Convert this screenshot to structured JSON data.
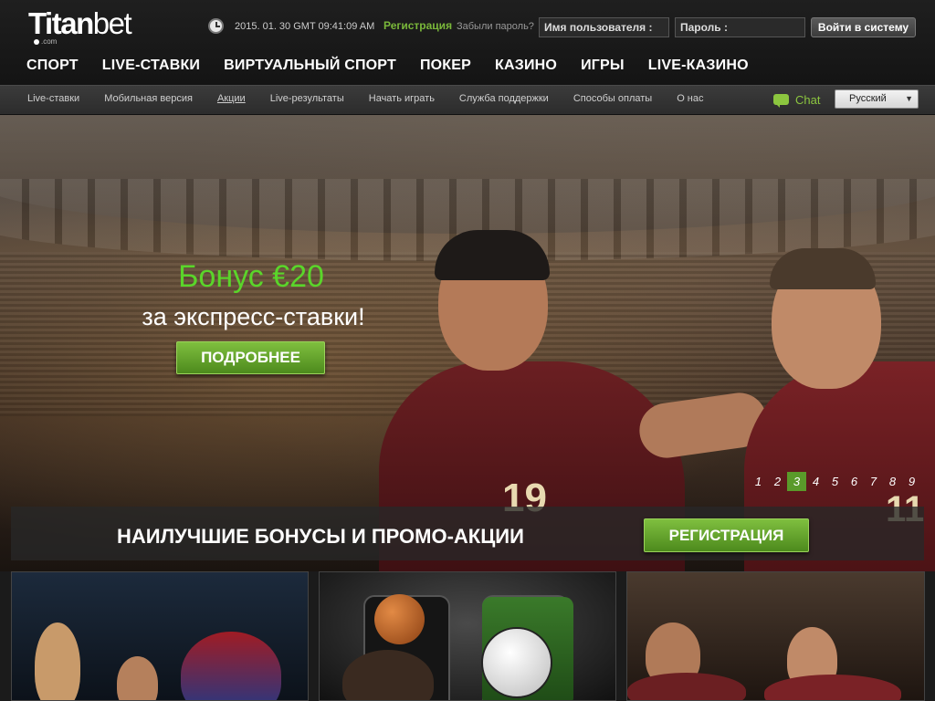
{
  "header": {
    "logo_text_bold": "Titan",
    "logo_text_light": "bet",
    "logo_sub": ".com",
    "datetime": "2015. 01. 30 GMT 09:41:09 AM",
    "register_link": "Регистрация",
    "forgot_password": "Забыли пароль?",
    "username_placeholder": "Имя пользователя :",
    "password_placeholder": "Пароль :",
    "login_button": "Войти в систему"
  },
  "main_nav": [
    {
      "label": "СПОРТ"
    },
    {
      "label": "LIVE-СТАВКИ"
    },
    {
      "label": "ВИРТУАЛЬНЫЙ СПОРТ"
    },
    {
      "label": "ПОКЕР"
    },
    {
      "label": "КАЗИНО"
    },
    {
      "label": "ИГРЫ"
    },
    {
      "label": "LIVE-КАЗИНО"
    }
  ],
  "sub_nav": [
    {
      "label": "Live-ставки"
    },
    {
      "label": "Мобильная версия"
    },
    {
      "label": "Акции",
      "active": true
    },
    {
      "label": "Live-результаты"
    },
    {
      "label": "Начать играть"
    },
    {
      "label": "Служба поддержки"
    },
    {
      "label": "Способы оплаты"
    },
    {
      "label": "О нас"
    }
  ],
  "chat": {
    "label": "Chat",
    "icon": "chat-bubble-icon",
    "color": "#8cc63f"
  },
  "language": {
    "selected": "Русский"
  },
  "hero": {
    "title": "Бонус €20",
    "subtitle": "за экспресс-ставки!",
    "details_button": "ПОДРОБНЕЕ",
    "player_number_left": "19",
    "player_number_right": "11",
    "slides": [
      "1",
      "2",
      "3",
      "4",
      "5",
      "6",
      "7",
      "8",
      "9"
    ],
    "active_slide": "3"
  },
  "promo_band": {
    "title": "НАИЛУЧШИЕ БОНУСЫ И ПРОМО-АКЦИИ",
    "register_button": "РЕГИСТРАЦИЯ"
  },
  "colors": {
    "accent_green": "#5ad52a",
    "button_green": "#4d8a1d",
    "background": "#1b1b1b"
  }
}
